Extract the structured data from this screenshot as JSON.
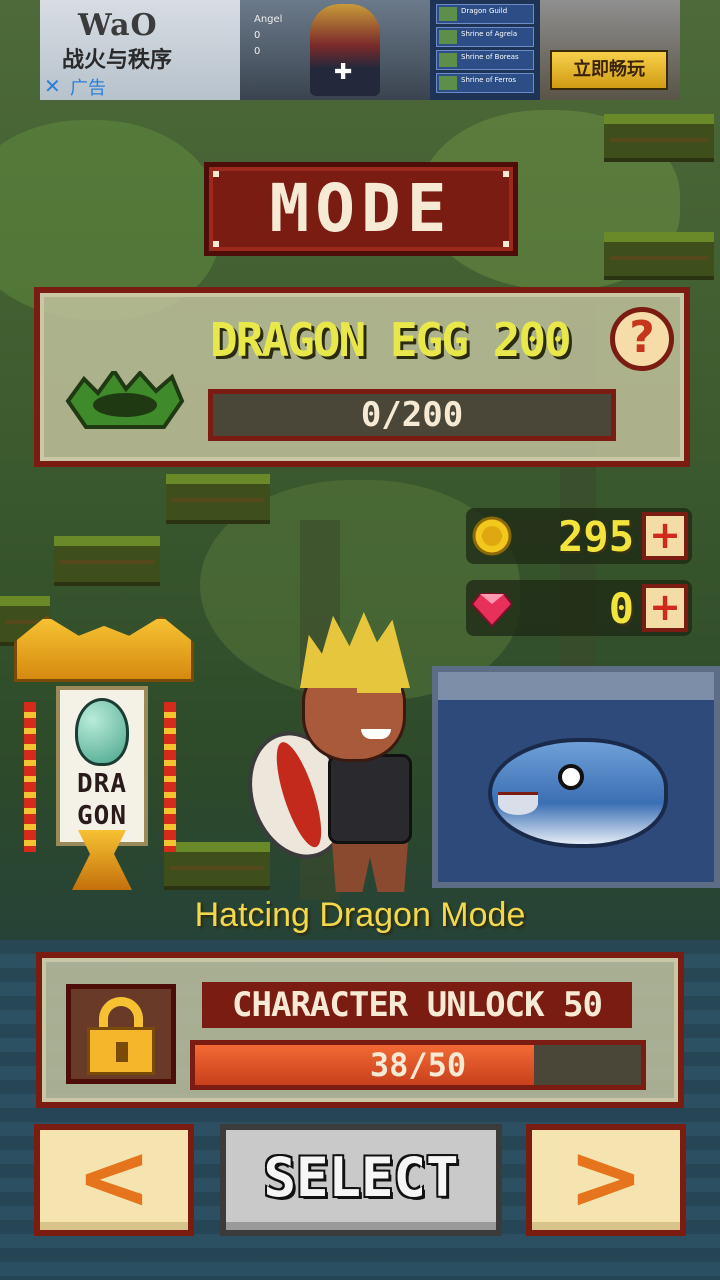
{
  "ad": {
    "brand": "WaO",
    "slogan": "战火与秩序",
    "close_label": "✕",
    "tag": "广告",
    "stat_name": "Angel",
    "stat_a": "0",
    "stat_b": "0",
    "list_items": [
      "Dragon Guild",
      "Shrine of Agrela",
      "Shrine of Boreas",
      "Shrine of Ferros"
    ],
    "cta": "立即畅玩"
  },
  "header": {
    "title": "MODE"
  },
  "egg": {
    "title": "DRAGON EGG 200",
    "help_label": "?",
    "progress_text": "0/200",
    "progress_value": 0,
    "progress_max": 200
  },
  "currency": {
    "coins": "295",
    "gems": "0",
    "plus_label": "+",
    "coin_icon": "coin-icon",
    "gem_icon": "gem-icon"
  },
  "shrine": {
    "banner_text_line1": "DRA",
    "banner_text_line2": "GON"
  },
  "mode": {
    "name": "Hatcing Dragon Mode"
  },
  "unlock": {
    "title": "CHARACTER UNLOCK 50",
    "progress_text": "38/50",
    "progress_value": 38,
    "progress_max": 50
  },
  "nav": {
    "prev_label": "<",
    "select_label": "SELECT",
    "next_label": ">"
  },
  "colors": {
    "frame": "#7a1c12",
    "accent_yellow": "#f2e43c",
    "progress_fill": "#e0522a",
    "button_cream": "#f6e4b0",
    "arrow_orange": "#e6741c"
  }
}
